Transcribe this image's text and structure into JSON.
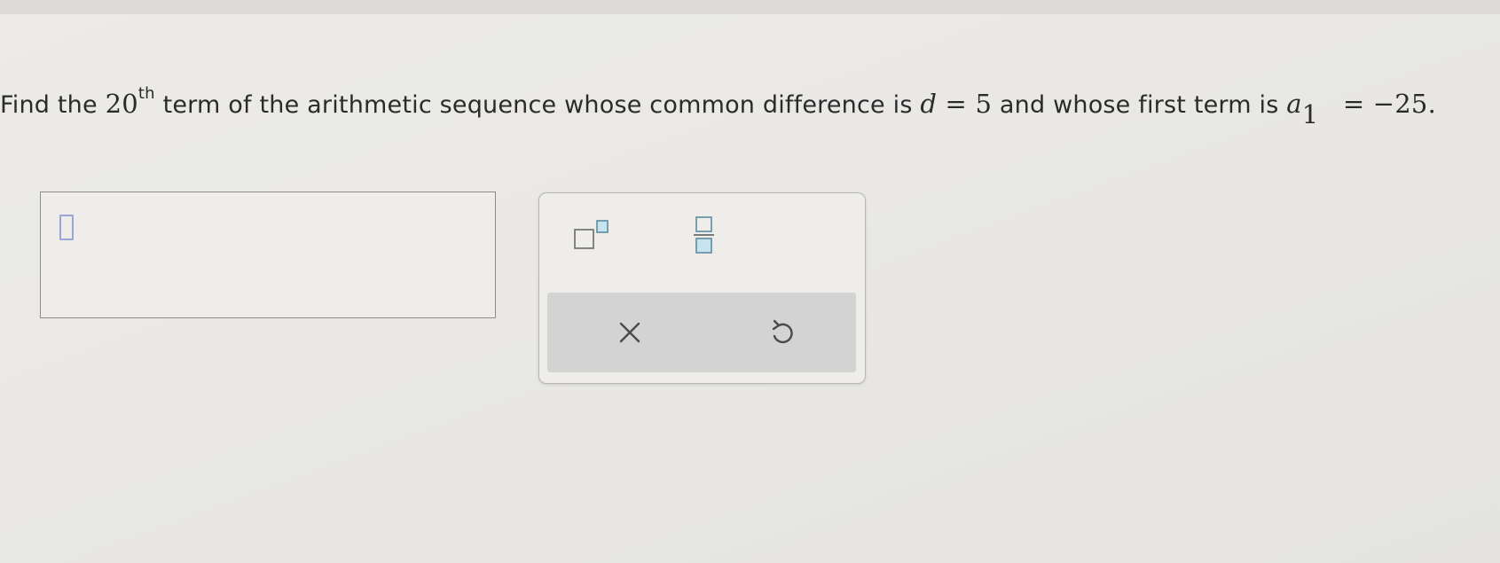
{
  "question": {
    "prefix": "Find the ",
    "ordinal_number": "20",
    "ordinal_suffix": "th",
    "mid_text": " term of the arithmetic sequence whose common difference is ",
    "d_var": "d",
    "d_equals": " = 5",
    "and_text": " and whose first term is ",
    "a_var": "a",
    "a_sub": "1",
    "a_equals": " = −25."
  },
  "answer": {
    "value": ""
  },
  "keypad": {
    "buttons": [
      {
        "name": "superscript",
        "icon": "superscript-template-icon"
      },
      {
        "name": "fraction",
        "icon": "fraction-template-icon"
      },
      {
        "name": "clear",
        "icon": "close-x-icon"
      },
      {
        "name": "undo",
        "icon": "undo-icon"
      }
    ]
  },
  "colors": {
    "placeholder_border": "#9aa7d6",
    "template_box_fill": "#c7e3ee",
    "template_box_border": "#5d8aa0",
    "action_bar": "#d3d3d3",
    "icon_dark": "#4a4a4a"
  }
}
